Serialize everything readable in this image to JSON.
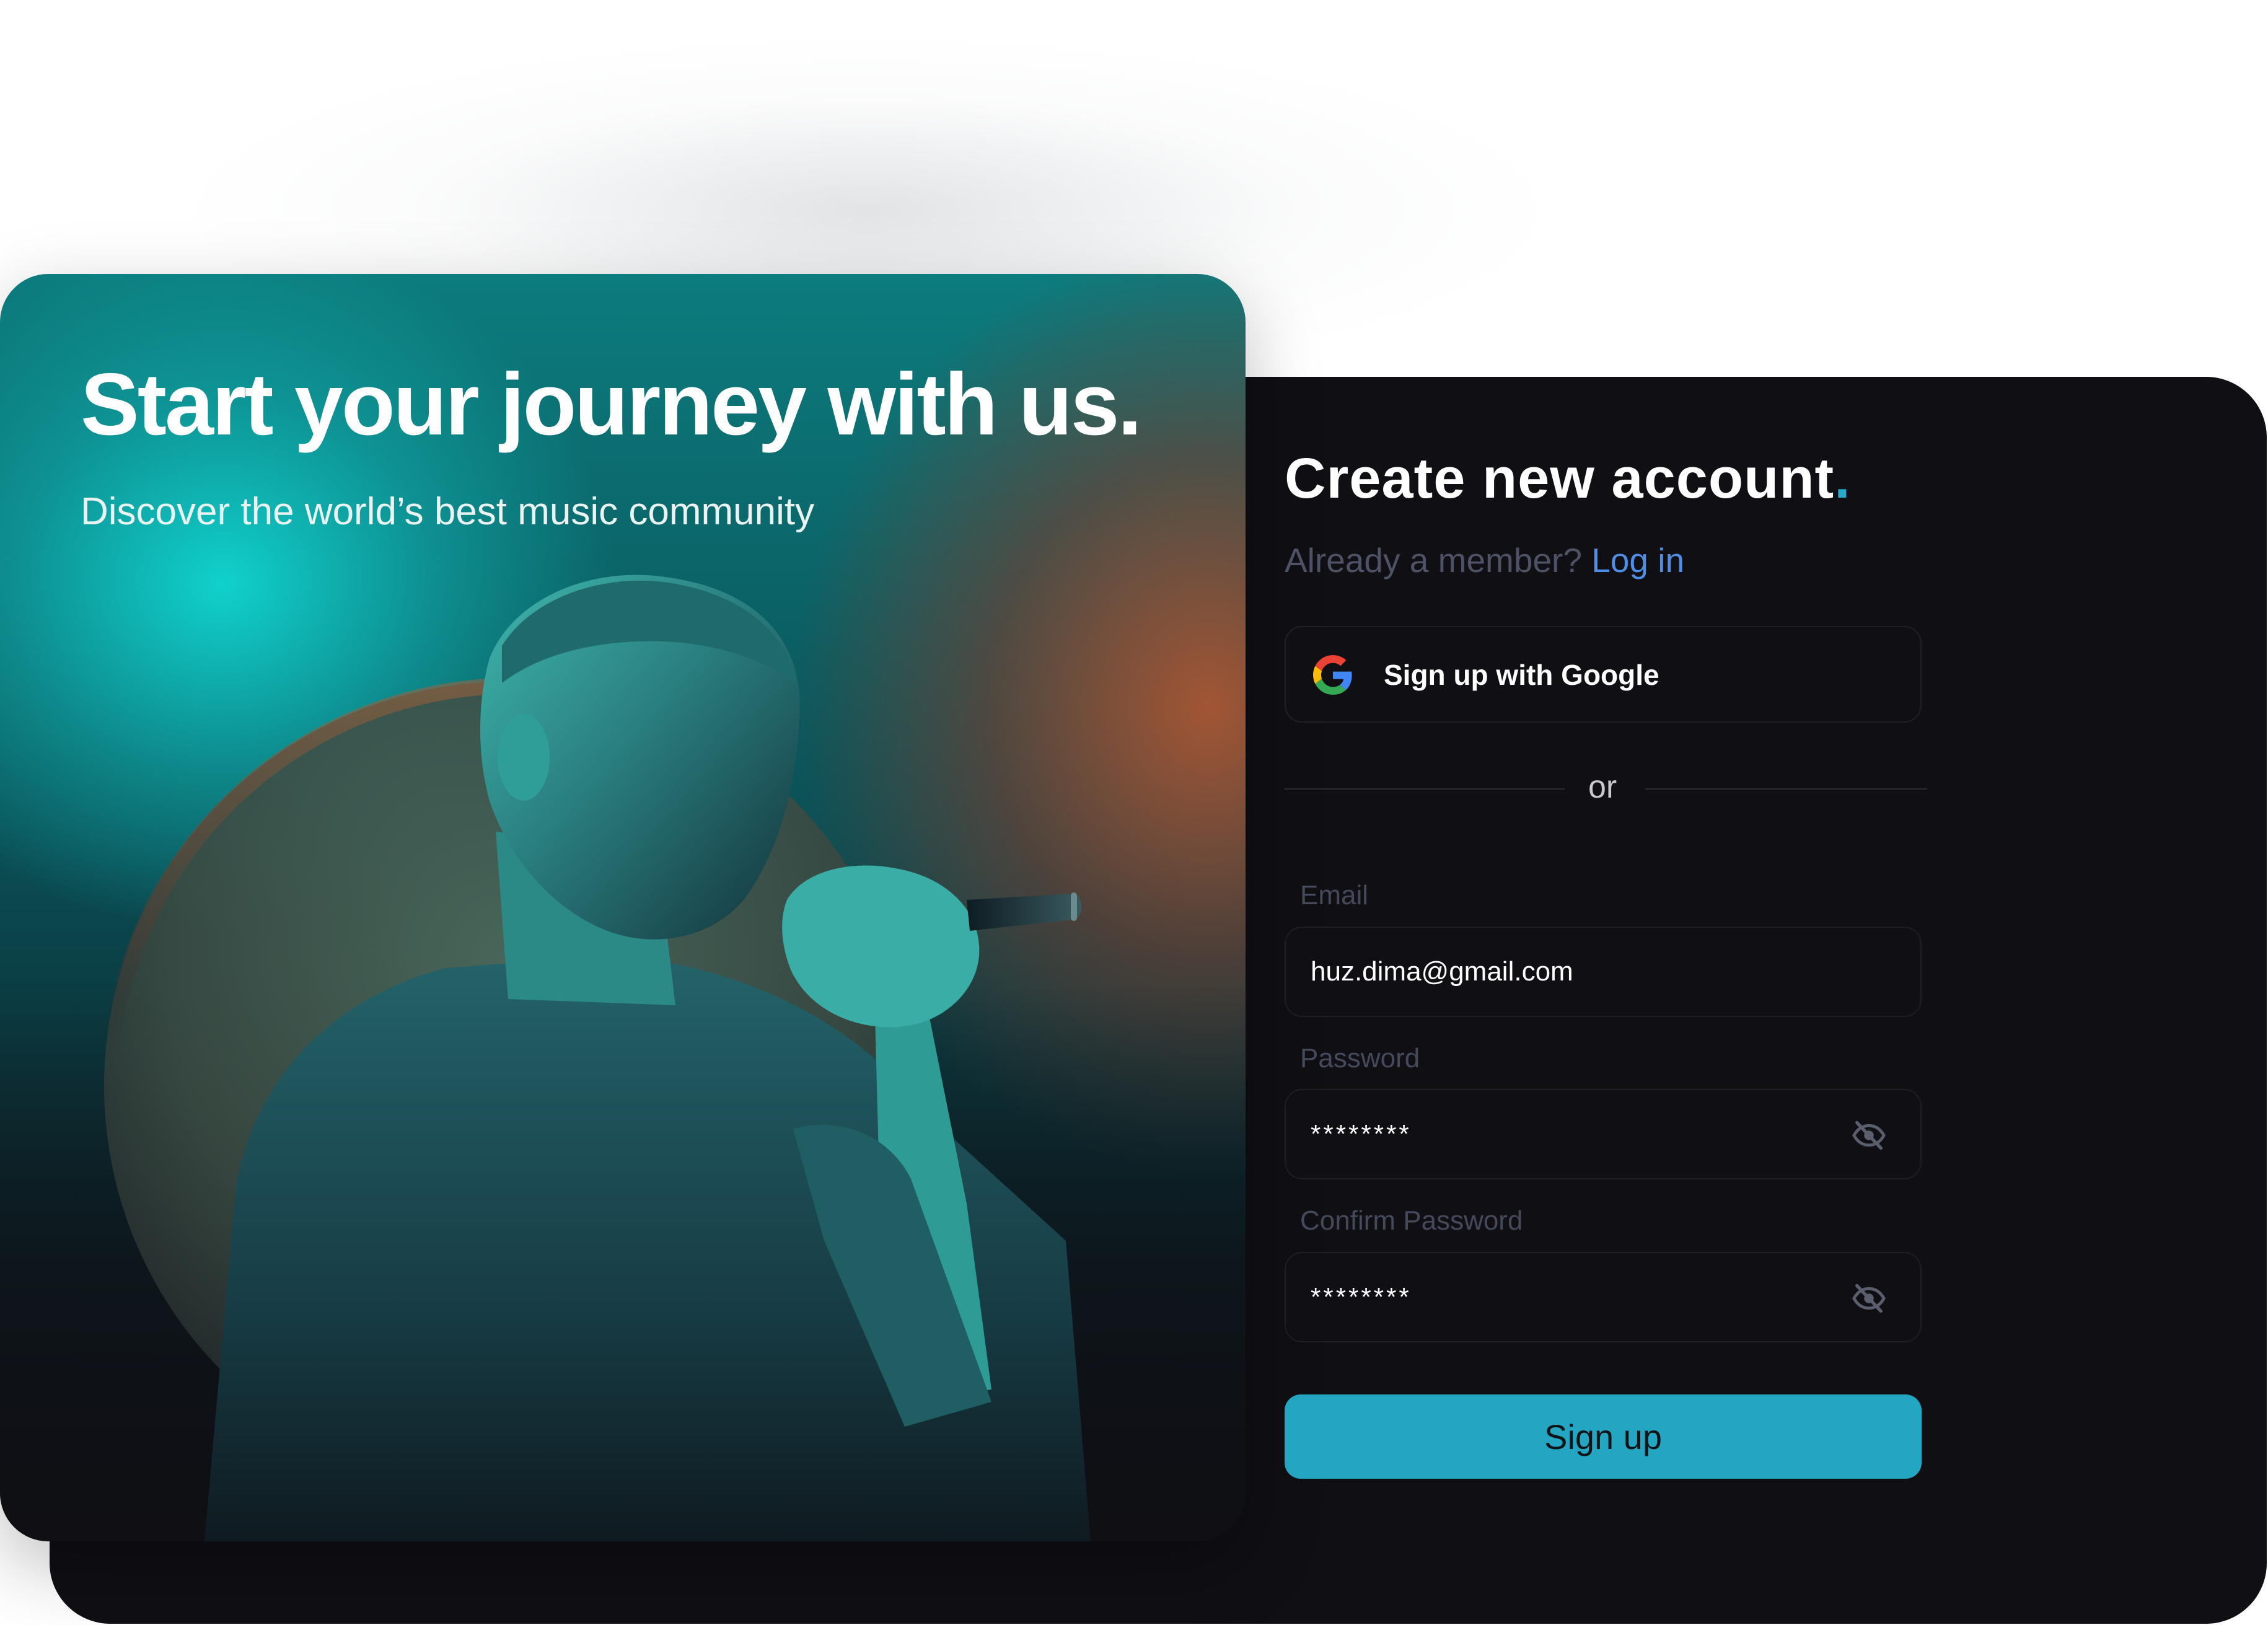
{
  "hero": {
    "title": "Start your journey with us.",
    "subtitle": "Discover the world’s best music community",
    "illustration_icon": "singer-with-microphone-icon"
  },
  "form": {
    "title": "Create new account",
    "title_dot": ".",
    "member_prompt": "Already a member? ",
    "login_link": "Log in",
    "google_button": "Sign up with Google",
    "divider_text": "or",
    "email": {
      "label": "Email",
      "value": "huz.dima@gmail.com"
    },
    "password": {
      "label": "Password",
      "value": "********"
    },
    "confirm_password": {
      "label": "Confirm Password",
      "value": "********"
    },
    "submit_button": "Sign up"
  },
  "colors": {
    "accent": "#24a6c2",
    "link": "#4f8ee6",
    "card_background": "#0f0f14",
    "title_dot": "#29a8c8"
  }
}
